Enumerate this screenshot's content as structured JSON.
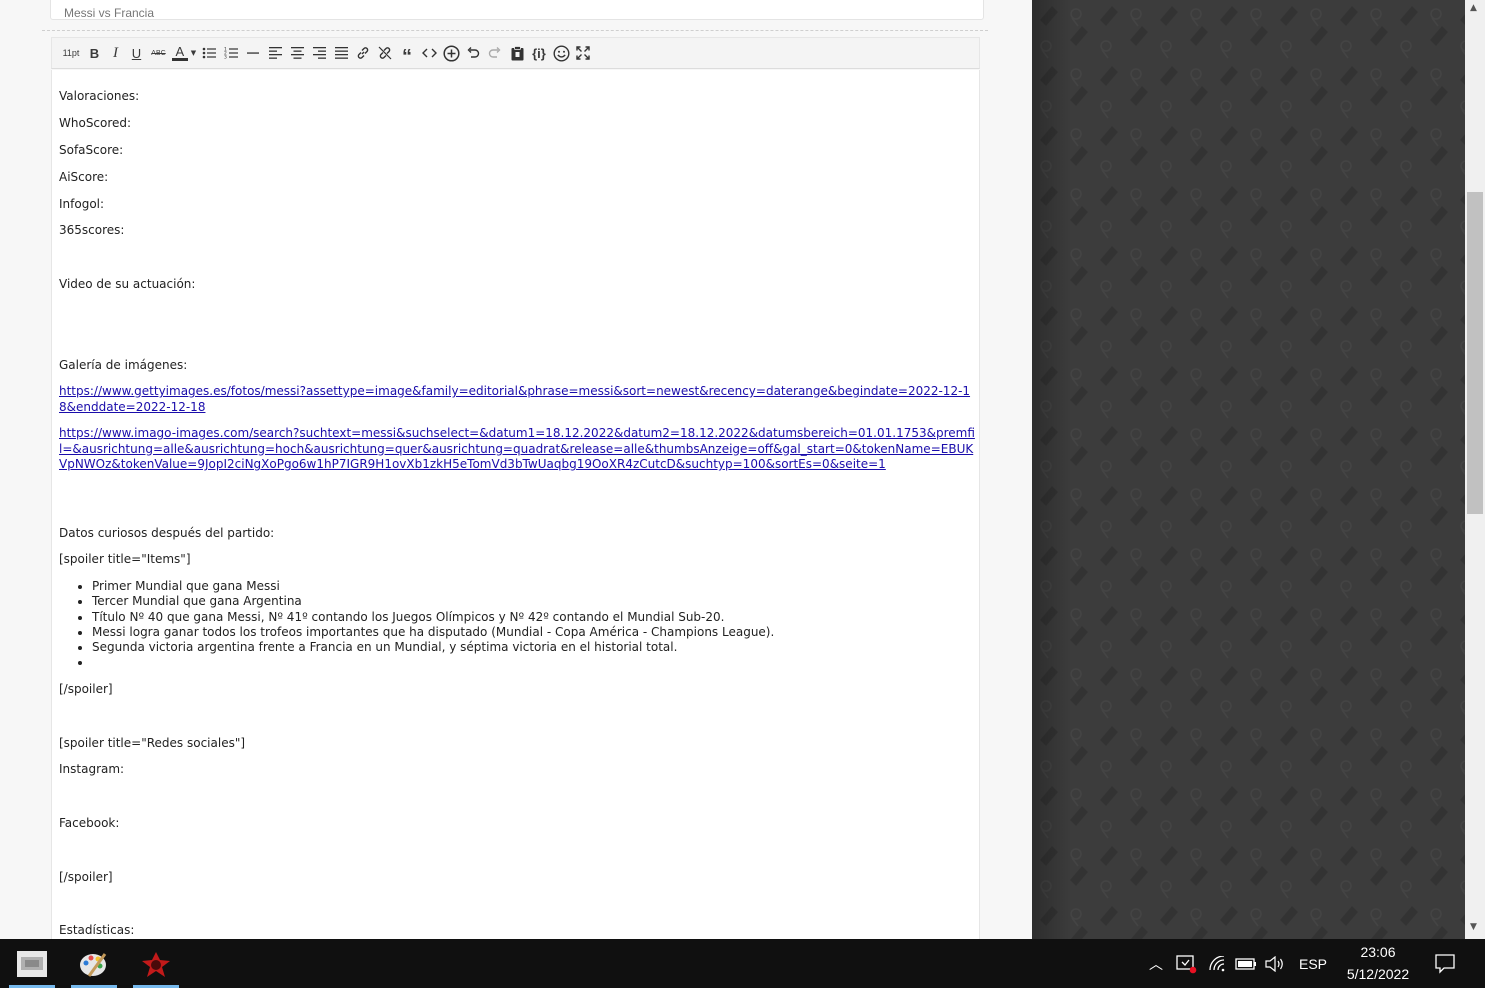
{
  "post": {
    "title": "Messi vs Francia"
  },
  "toolbar": {
    "font_size": "11pt",
    "bold": "B",
    "italic": "I",
    "underline": "U",
    "strike": "ABC",
    "font_color": "A"
  },
  "content": {
    "valoraciones": "Valoraciones:",
    "whoscored": "WhoScored:",
    "sofascore": "SofaScore:",
    "aiscore": "AiScore:",
    "infogol": "Infogol:",
    "scores365": "365scores:",
    "video": "Video de su actuación:",
    "galeria": "Galería de imágenes:",
    "link1": "https://www.gettyimages.es/fotos/messi?assettype=image&family=editorial&phrase=messi&sort=newest&recency=daterange&begindate=2022-12-18&enddate=2022-12-18",
    "link2": "https://www.imago-images.com/search?suchtext=messi&suchselect=&datum1=18.12.2022&datum2=18.12.2022&datumsbereich=01.01.1753&premfil=&ausrichtung=alle&ausrichtung=hoch&ausrichtung=quer&ausrichtung=quadrat&release=alle&thumbsAnzeige=off&gal_start=0&tokenName=EBUKVpNWOz&tokenValue=9JopI2ciNgXoPgo6w1hP7IGR9H1ovXb1zkH5eTomVd3bTwUaqbg19OoXR4zCutcD&suchtyp=100&sortEs=0&seite=1",
    "datos": "Datos curiosos después del partido:",
    "spoiler_items_open": "[spoiler title=\"Items\"]",
    "items": [
      "Primer Mundial que gana Messi",
      "Tercer Mundial que gana Argentina",
      "Título Nº 40 que gana Messi, Nº 41º contando los Juegos Olímpicos y Nº 42º contando el Mundial Sub-20.",
      "Messi logra ganar todos los trofeos importantes que ha disputado (Mundial - Copa América - Champions League).",
      "Segunda victoria argentina frente a Francia en un Mundial, y séptima victoria en el historial total.",
      ""
    ],
    "spoiler_close_1": "[/spoiler]",
    "spoiler_redes_open": "[spoiler title=\"Redes sociales\"]",
    "instagram": "Instagram:",
    "facebook": "Facebook:",
    "spoiler_close_2": "[/spoiler]",
    "estadisticas": "Estadísticas:"
  },
  "taskbar": {
    "language": "ESP",
    "time": "23:06",
    "date": "5/12/2022",
    "apps": [
      "file-explorer-app",
      "paint-app",
      "game-app"
    ]
  },
  "colors": {
    "link": "#1a0dab",
    "side_panel": "#3c3c3c",
    "taskbar": "#101010",
    "taskbar_active": "#76b9ed"
  }
}
